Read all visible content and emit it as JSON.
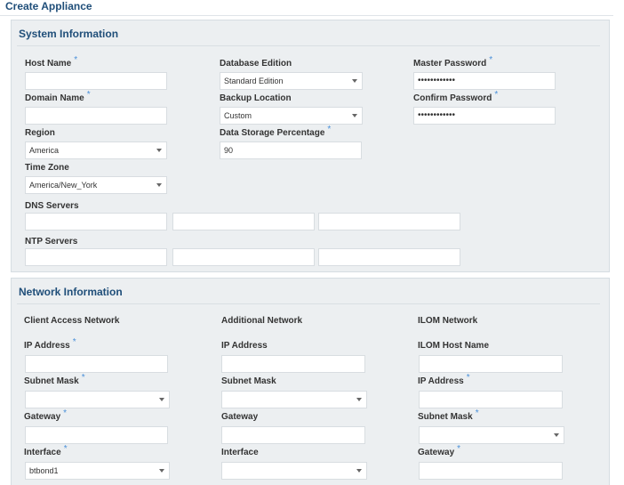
{
  "page": {
    "title": "Create Appliance"
  },
  "system": {
    "title": "System Information",
    "host_name": {
      "label": "Host Name",
      "value": ""
    },
    "domain_name": {
      "label": "Domain Name",
      "value": ""
    },
    "region": {
      "label": "Region",
      "value": "America"
    },
    "time_zone": {
      "label": "Time Zone",
      "value": "America/New_York"
    },
    "dns_servers": {
      "label": "DNS Servers",
      "values": [
        "",
        "",
        ""
      ]
    },
    "ntp_servers": {
      "label": "NTP Servers",
      "values": [
        "",
        "",
        ""
      ]
    },
    "database_edition": {
      "label": "Database Edition",
      "value": "Standard Edition"
    },
    "backup_location": {
      "label": "Backup Location",
      "value": "Custom"
    },
    "data_storage": {
      "label": "Data Storage Percentage",
      "value": "90"
    },
    "master_password": {
      "label": "Master Password",
      "value": "••••••••••••"
    },
    "confirm_password": {
      "label": "Confirm Password",
      "value": "••••••••••••"
    }
  },
  "network": {
    "title": "Network Information",
    "client": {
      "title": "Client Access Network",
      "ip_label": "IP Address",
      "subnet_label": "Subnet Mask",
      "gateway_label": "Gateway",
      "interface_label": "Interface",
      "interface_value": "btbond1"
    },
    "additional": {
      "title": "Additional Network",
      "ip_label": "IP Address",
      "subnet_label": "Subnet Mask",
      "gateway_label": "Gateway",
      "interface_label": "Interface",
      "interface_value": ""
    },
    "ilom": {
      "title": "ILOM Network",
      "host_label": "ILOM Host Name",
      "ip_label": "IP Address",
      "subnet_label": "Subnet Mask",
      "gateway_label": "Gateway"
    }
  },
  "required_marker": "*"
}
